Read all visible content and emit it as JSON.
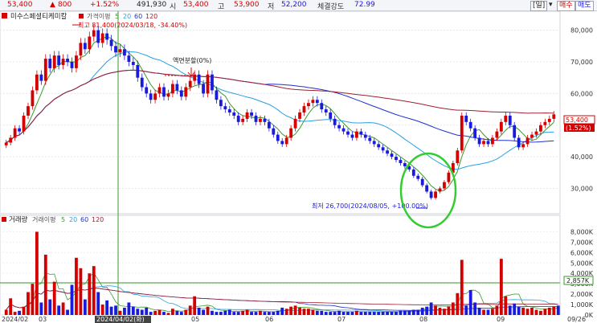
{
  "header": {
    "price": "53,400",
    "change": "800",
    "change_pct": "+1.52%",
    "volume": "491,930",
    "open_label": "시",
    "open": "53,400",
    "high_label": "고",
    "high": "53,900",
    "low_label": "저",
    "low": "52,200",
    "strength_label": "체결강도",
    "strength": "72.99",
    "period_button": "[일]",
    "buy_button": "매수",
    "sell_button": "매도"
  },
  "price_panel": {
    "stock_name": "미수스페셜티케미칼",
    "ma_label": "가격이평",
    "ma_periods": [
      "5",
      "20",
      "60",
      "120"
    ],
    "high_annotation": "최고 81,400(2024/03/18, -34.40%)",
    "split_annotation": "액면분할(0%)",
    "low_annotation": "최저 26,700(2024/08/05, +100.00%)",
    "y_ticks": [
      "80,000",
      "70,000",
      "60,000",
      "50,000",
      "40,000",
      "30,000"
    ],
    "current_price_tag": "53,400",
    "current_pct_tag": "(1.52%)"
  },
  "volume_panel": {
    "title": "거래량",
    "ma_label": "거래이평",
    "ma_periods": [
      "5",
      "20",
      "60",
      "120"
    ],
    "y_ticks": [
      "8,000K",
      "7,000K",
      "6,000K",
      "5,000K",
      "4,000K",
      "3,000K",
      "2,000K",
      "1,000K",
      "0K"
    ],
    "current_tag": "2,857K",
    "current_tag2": "0K"
  },
  "x_axis": {
    "labels": [
      "2024/02",
      "03",
      "2024/04/02(화)",
      "05",
      "06",
      "07",
      "08",
      "09",
      "09/26"
    ]
  },
  "colors": {
    "up": "#d40000",
    "down": "#1a1adc",
    "ma5": "#3a9a2a",
    "ma20": "#2aa0e0",
    "ma60": "#2030d0",
    "ma120": "#a02030",
    "highlight": "#33cc33"
  },
  "chart_data": {
    "type": "candlestick",
    "ylim": [
      22000,
      86000
    ],
    "volume_ylim": [
      0,
      8500
    ],
    "notable_points": [
      {
        "label": "high",
        "date": "2024/03/18",
        "value": 81400
      },
      {
        "label": "low",
        "date": "2024/08/05",
        "value": 26700
      }
    ],
    "closes": [
      44500,
      46000,
      49000,
      48000,
      53000,
      56000,
      61000,
      66000,
      64000,
      71000,
      68000,
      72000,
      69000,
      71000,
      70000,
      68000,
      72000,
      76000,
      74000,
      78000,
      80000,
      76000,
      79000,
      77000,
      75000,
      73000,
      74000,
      72000,
      70000,
      69000,
      65000,
      62000,
      60000,
      58000,
      60000,
      62000,
      59000,
      60000,
      63000,
      61000,
      59000,
      62000,
      64000,
      66000,
      63000,
      60000,
      66000,
      61000,
      58000,
      56000,
      55000,
      54000,
      53000,
      51000,
      52000,
      54000,
      53000,
      51000,
      52000,
      51000,
      49000,
      47000,
      45000,
      44000,
      46000,
      49000,
      52000,
      54000,
      56000,
      57000,
      58000,
      57000,
      55000,
      54000,
      52000,
      50000,
      49000,
      48000,
      47000,
      46000,
      48000,
      47000,
      46000,
      45000,
      44000,
      43000,
      42000,
      41000,
      40000,
      39000,
      38000,
      37000,
      36000,
      34000,
      33000,
      31000,
      29000,
      27000,
      29000,
      30000,
      32000,
      35000,
      38000,
      42000,
      53000,
      51000,
      49000,
      46000,
      44000,
      45000,
      44000,
      46000,
      48000,
      51000,
      53000,
      50000,
      46000,
      43000,
      44000,
      46000,
      47000,
      48000,
      50000,
      51000,
      52000,
      53400
    ],
    "volumes_k": [
      500,
      1600,
      300,
      400,
      800,
      2200,
      3000,
      8000,
      1200,
      5800,
      1500,
      3200,
      900,
      1200,
      500,
      2900,
      5500,
      4500,
      1500,
      4000,
      4700,
      2200,
      1000,
      1400,
      800,
      900,
      400,
      700,
      1200,
      800,
      600,
      500,
      700,
      300,
      400,
      500,
      300,
      200,
      600,
      400,
      300,
      500,
      900,
      1800,
      700,
      500,
      800,
      400,
      300,
      300,
      400,
      500,
      300,
      300,
      400,
      500,
      300,
      300,
      400,
      300,
      300,
      300,
      400,
      700,
      600,
      800,
      900,
      700,
      600,
      600,
      500,
      400,
      400,
      300,
      300,
      300,
      400,
      300,
      300,
      300,
      400,
      300,
      300,
      300,
      300,
      300,
      300,
      300,
      300,
      300,
      400,
      400,
      400,
      500,
      500,
      700,
      800,
      1200,
      900,
      700,
      600,
      800,
      1200,
      2100,
      5300,
      900,
      2400,
      1200,
      700,
      500,
      500,
      600,
      900,
      5400,
      1800,
      900,
      1100,
      800,
      700,
      600,
      700,
      500,
      400,
      600,
      700,
      800,
      900
    ]
  }
}
